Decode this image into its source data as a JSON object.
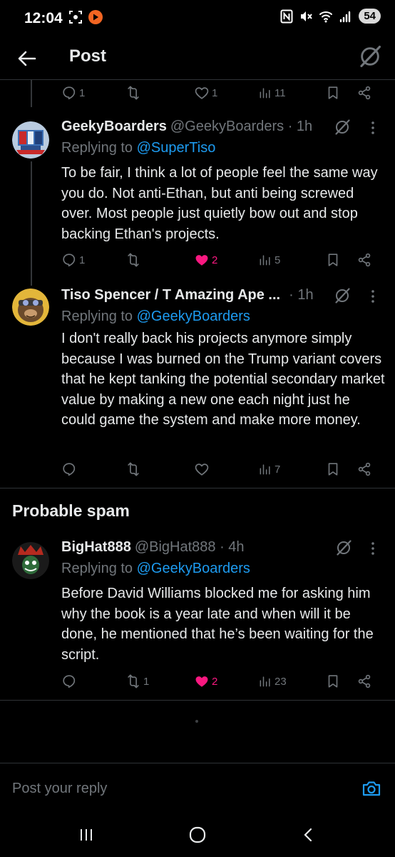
{
  "status_bar": {
    "time": "12:04",
    "battery": "54"
  },
  "header": {
    "title": "Post"
  },
  "top_actions": {
    "reply_count": "1",
    "repost_count": "",
    "like_count": "1",
    "view_count": "11"
  },
  "posts": [
    {
      "name": "GeekyBoarders",
      "handle": "@GeekyBoarders · 1h",
      "replying_label": "Replying to",
      "replying_to": "@SuperTiso",
      "text": "To be fair, I think a lot of people feel the same way you do. Not anti-Ethan, but anti being screwed over. Most people just quietly bow out and stop backing Ethan's projects.",
      "reply_count": "1",
      "repost_count": "",
      "like_count": "2",
      "view_count": "5",
      "liked": true
    },
    {
      "name": "Tiso Spencer / T Amazing Ape ...",
      "handle": "· 1h",
      "replying_label": "Replying to",
      "replying_to": "@GeekyBoarders",
      "text": "I don't really back his projects anymore simply because I was burned on the Trump variant covers that he kept tanking the potential secondary market value by making a new one each night just he could game the system and make more money.",
      "reply_count": "",
      "repost_count": "",
      "like_count": "",
      "view_count": "7",
      "liked": false
    },
    {
      "name": "BigHat888",
      "handle": "@BigHat888 · 4h",
      "replying_label": "Replying to",
      "replying_to": "@GeekyBoarders",
      "text": "Before David Williams blocked me for asking him why the book is a year late and when will it be done, he mentioned that he’s been waiting for the script.",
      "reply_count": "",
      "repost_count": "1",
      "like_count": "2",
      "view_count": "23",
      "liked": true
    }
  ],
  "spam_section": {
    "heading": "Probable spam"
  },
  "reply_bar": {
    "placeholder": "Post your reply"
  },
  "colors": {
    "background": "#000000",
    "text": "#e7e9ea",
    "muted": "#71767b",
    "accent": "#1d9bf0",
    "like": "#f91880"
  },
  "icons": {
    "back": "arrow-left-icon",
    "grok": "grok-icon",
    "reply": "speech-bubble-icon",
    "repost": "repost-icon",
    "like": "heart-icon",
    "views": "bar-chart-icon",
    "bookmark": "bookmark-icon",
    "share": "share-icon",
    "more": "more-vertical-icon",
    "camera": "camera-icon"
  }
}
